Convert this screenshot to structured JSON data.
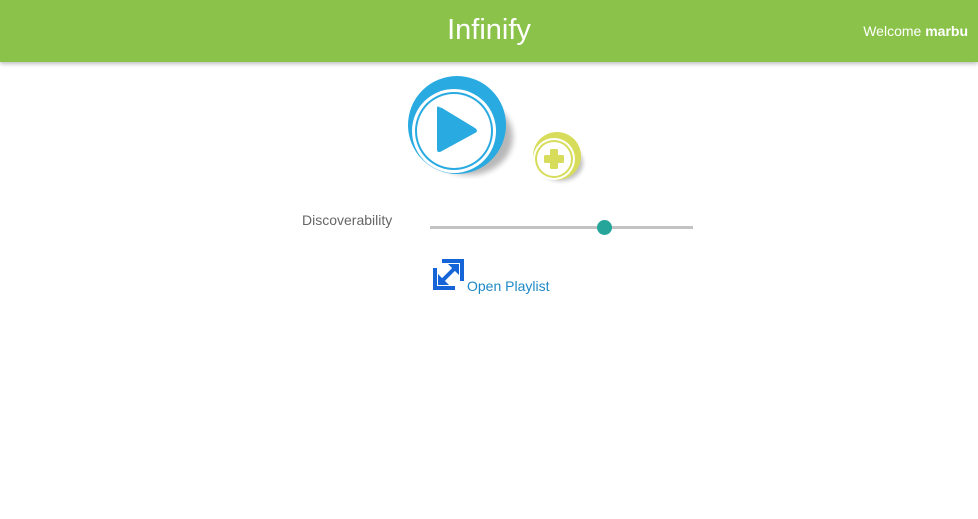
{
  "header": {
    "title": "Infinify",
    "welcome_prefix": "Welcome",
    "username": "marbu"
  },
  "controls": {
    "play_icon": "play-icon",
    "add_icon": "plus-icon"
  },
  "discoverability": {
    "label": "Discoverability",
    "value_fraction": 0.66
  },
  "playlist": {
    "icon": "expand-arrows-icon",
    "label": "Open Playlist"
  },
  "colors": {
    "header_bg": "#8bc34a",
    "play_blue": "#29abe2",
    "add_yellow": "#d7dc5a",
    "slider_thumb": "#26a69a",
    "link_blue": "#1e88c6"
  }
}
